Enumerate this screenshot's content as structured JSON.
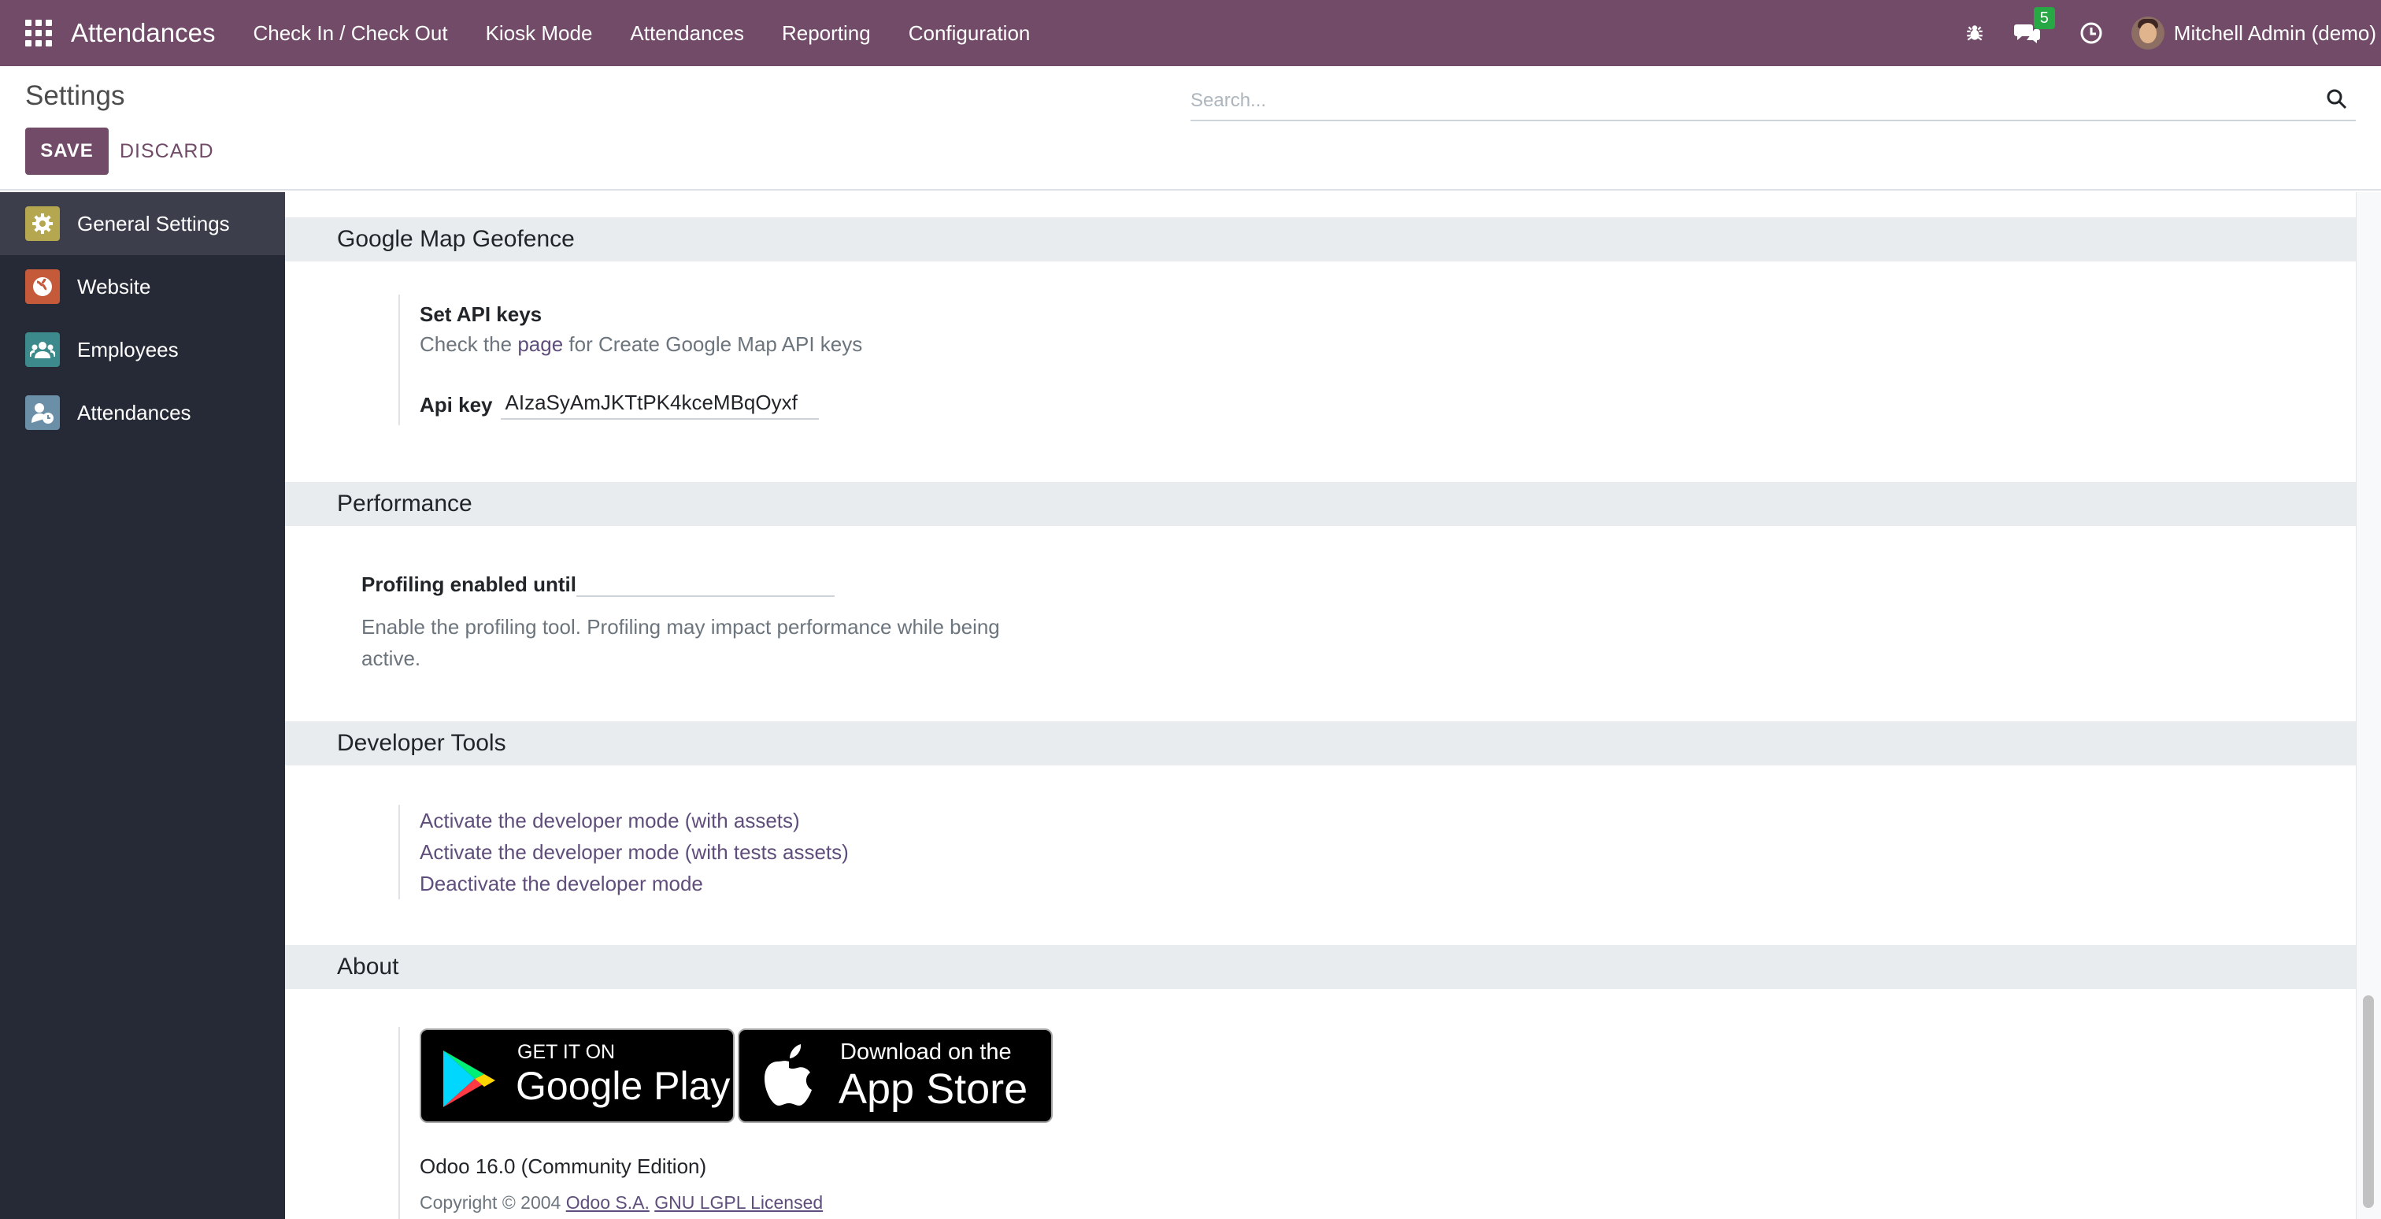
{
  "nav": {
    "app_name": "Attendances",
    "menu": [
      "Check In / Check Out",
      "Kiosk Mode",
      "Attendances",
      "Reporting",
      "Configuration"
    ],
    "messages_count": "5",
    "user": "Mitchell Admin (demo)",
    "accent_color": "#714b67"
  },
  "control": {
    "title": "Settings",
    "save_label": "SAVE",
    "discard_label": "DISCARD",
    "search_placeholder": "Search..."
  },
  "sidebar": {
    "items": [
      {
        "label": "General Settings",
        "icon": "gear-icon",
        "active": true
      },
      {
        "label": "Website",
        "icon": "globe-icon"
      },
      {
        "label": "Employees",
        "icon": "users-icon"
      },
      {
        "label": "Attendances",
        "icon": "attendance-icon"
      }
    ]
  },
  "sections": {
    "geofence": {
      "title": "Google Map Geofence",
      "setting_title": "Set API keys",
      "desc_prefix": "Check the",
      "desc_link": "page",
      "desc_suffix": "for Create Google Map API keys",
      "api_label": "Api key",
      "api_value": "AIzaSyAmJKTtPK4kceMBqOyxf"
    },
    "performance": {
      "title": "Performance",
      "label": "Profiling enabled until",
      "desc_line1": "Enable the profiling tool. Profiling may impact performance while being",
      "desc_line2": "active."
    },
    "developer": {
      "title": "Developer Tools",
      "links": [
        "Activate the developer mode (with assets)",
        "Activate the developer mode (with tests assets)",
        "Deactivate the developer mode"
      ]
    },
    "about": {
      "title": "About",
      "google_play_top": "GET IT ON",
      "google_play_bottom": "Google Play",
      "app_store_top": "Download on the",
      "app_store_bottom": "App Store",
      "version": "Odoo 16.0 (Community Edition)",
      "copyright_prefix": "Copyright © 2004",
      "company": "Odoo S.A.",
      "license": "GNU LGPL Licensed"
    }
  }
}
